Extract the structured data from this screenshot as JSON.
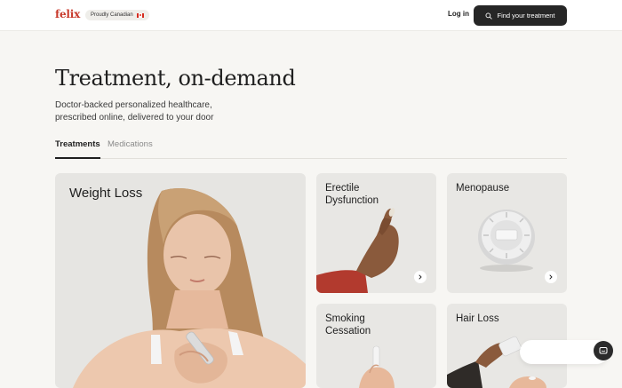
{
  "header": {
    "logo": "felix",
    "badge_label": "Proudly Canadian",
    "badge_flag_icon": "canada-flag-icon",
    "login_label": "Log in",
    "find_button_label": "Find your treatment",
    "find_button_icon": "search-icon"
  },
  "hero": {
    "title": "Treatment, on-demand",
    "subtitle": "Doctor-backed personalized healthcare, prescribed online, delivered to your door"
  },
  "tabs": [
    {
      "label": "Treatments",
      "active": true
    },
    {
      "label": "Medications",
      "active": false
    }
  ],
  "cards": [
    {
      "title": "Weight Loss",
      "icon": "woman-injecting-pen-image"
    },
    {
      "title": "Erectile Dysfunction",
      "icon": "hand-holding-pill-image",
      "arrow_icon": "chevron-right-icon"
    },
    {
      "title": "Menopause",
      "icon": "pill-dispenser-image",
      "arrow_icon": "chevron-right-icon"
    },
    {
      "title": "Smoking Cessation",
      "icon": "hand-holding-vial-image"
    },
    {
      "title": "Hair Loss",
      "icon": "hand-pouring-pill-image"
    }
  ],
  "chat": {
    "icon": "chat-icon"
  },
  "colors": {
    "background": "#f7f6f3",
    "brand_red": "#c8392b",
    "button_dark": "#262626",
    "card_bg": "#e8e7e4"
  }
}
